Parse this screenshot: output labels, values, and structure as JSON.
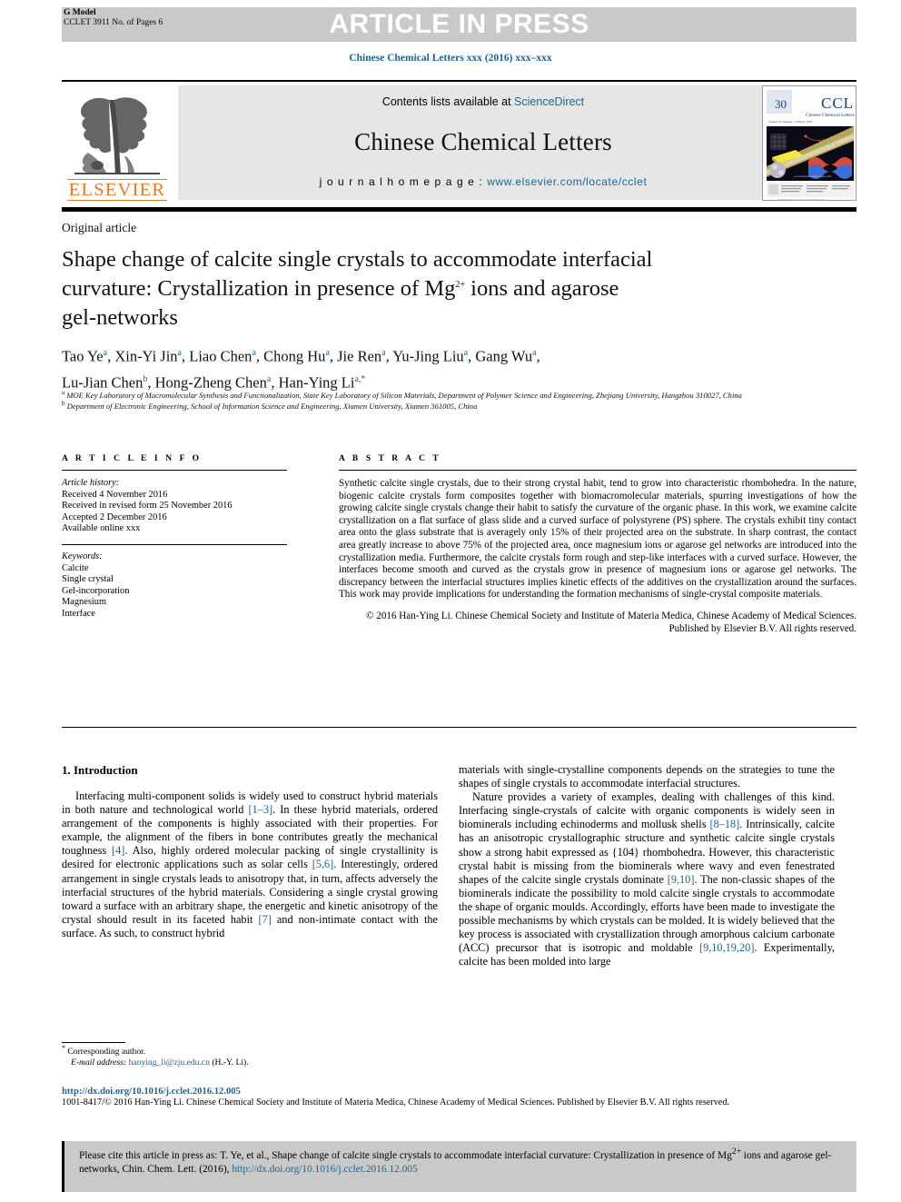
{
  "header": {
    "g_model_label": "G Model",
    "g_model_code": "CCLET 3911 No. of Pages 6",
    "article_in_press": "ARTICLE IN PRESS",
    "journal_ref": "Chinese Chemical Letters xxx (2016) xxx–xxx"
  },
  "masthead": {
    "contents_prefix": "Contents lists available at ",
    "sciencedirect": "ScienceDirect",
    "journal_title": "Chinese Chemical Letters",
    "homepage_label": "j o u r n a l  h o m e p a g e :  ",
    "homepage_url": "www.elsevier.com/locate/cclet",
    "publisher": "ELSEVIER",
    "cover_code": "CCL",
    "cover_sub": "Chinese Chemical Letters"
  },
  "title_block": {
    "article_type": "Original article",
    "title_line1": "Shape change of calcite single crystals to accommodate interfacial",
    "title_line2_a": "curvature: Crystallization in presence of Mg",
    "title_line2_sup": "2+",
    "title_line2_b": " ions and agarose",
    "title_line3": "gel-networks",
    "authors": "Tao Ye<a>, Xin-Yi Jin<a>, Liao Chen<a>, Chong Hu<a>, Jie Ren<a>, Yu-Jing Liu<a>, Gang Wu<a>, Lu-Jian Chen<b>, Hong-Zheng Chen<a>, Han-Ying Li<a,*>",
    "affiliation_a": "MOE Key Laboratory of Macromolecular Synthesis and Functionalization, State Key Laboratory of Silicon Materials, Department of Polymer Science and Engineering, Zhejiang University, Hangzhou 310027, China",
    "affiliation_b": "Department of Electronic Engineering, School of Information Science and Engineering, Xiamen University, Xiamen 361005, China"
  },
  "article_info": {
    "heading": "A R T I C L E   I N F O",
    "history_label": "Article history:",
    "history": [
      "Received 4 November 2016",
      "Received in revised form 25 November 2016",
      "Accepted 2 December 2016",
      "Available online xxx"
    ],
    "keywords_label": "Keywords:",
    "keywords": [
      "Calcite",
      "Single crystal",
      "Gel-incorporation",
      "Magnesium",
      "Interface"
    ]
  },
  "abstract": {
    "heading": "A B S T R A C T",
    "text": "Synthetic calcite single crystals, due to their strong crystal habit, tend to grow into characteristic rhombohedra. In the nature, biogenic calcite crystals form composites together with biomacromolecular materials, spurring investigations of how the growing calcite single crystals change their habit to satisfy the curvature of the organic phase. In this work, we examine calcite crystallization on a flat surface of glass slide and a curved surface of polystyrene (PS) sphere. The crystals exhibit tiny contact area onto the glass substrate that is averagely only 15% of their projected area on the substrate. In sharp contrast, the contact area greatly increase to above 75% of the projected area, once magnesium ions or agarose gel networks are introduced into the crystallization media. Furthermore, the calcite crystals form rough and step-like interfaces with a curved surface. However, the interfaces become smooth and curved as the crystals grow in presence of magnesium ions or agarose gel networks. The discrepancy between the interfacial structures implies kinetic effects of the additives on the crystallization around the surfaces. This work may provide implications for understanding the formation mechanisms of single-crystal composite materials.",
    "copyright": "© 2016 Han-Ying Li. Chinese Chemical Society and Institute of Materia Medica, Chinese Academy of Medical Sciences. Published by Elsevier B.V. All rights reserved."
  },
  "body": {
    "section_heading": "1. Introduction",
    "left_p1_a": "Interfacing multi-component solids is widely used to construct hybrid materials in both nature and technological world ",
    "left_p1_ref1": "[1–3]",
    "left_p1_b": ". In these hybrid materials, ordered arrangement of the components is highly associated with their properties. For example, the alignment of the fibers in bone contributes greatly the mechanical toughness ",
    "left_p1_ref2": "[4]",
    "left_p1_c": ". Also, highly ordered molecular packing of single crystallinity is desired for electronic applications such as solar cells ",
    "left_p1_ref3": "[5,6]",
    "left_p1_d": ". Interestingly, ordered arrangement in single crystals leads to anisotropy that, in turn, affects adversely the interfacial structures of the hybrid materials. Considering a single crystal growing toward a surface with an arbitrary shape, the energetic and kinetic anisotropy of the crystal should result in its faceted habit ",
    "left_p1_ref4": "[7]",
    "left_p1_e": " and non-intimate contact with the surface. As such, to construct hybrid",
    "right_p1": "materials with single-crystalline components depends on the strategies to tune the shapes of single crystals to accommodate interfacial structures.",
    "right_p2_a": "Nature provides a variety of examples, dealing with challenges of this kind. Interfacing single-crystals of calcite with organic components is widely seen in biominerals including echinoderms and mollusk shells ",
    "right_p2_ref1": "[8–18]",
    "right_p2_b": ". Intrinsically, calcite has an anisotropic crystallographic structure and synthetic calcite single crystals show a strong habit expressed as {104} rhombohedra. However, this characteristic crystal habit is missing from the biominerals where wavy and even fenestrated shapes of the calcite single crystals dominate ",
    "right_p2_ref2": "[9,10]",
    "right_p2_c": ". The non-classic shapes of the biominerals indicate the possibility to mold calcite single crystals to accommodate the shape of organic moulds. Accordingly, efforts have been made to investigate the possible mechanisms by which crystals can be molded. It is widely believed that the key process is associated with crystallization through amorphous calcium carbonate (ACC) precursor that is isotropic and moldable ",
    "right_p2_ref3": "[9,10,19,20]",
    "right_p2_d": ". Experimentally, calcite has been molded into large"
  },
  "footnote": {
    "corresponding": "Corresponding author.",
    "email_label": "E-mail address:",
    "email": "hanying_li@zju.edu.cn",
    "email_owner": "(H.-Y. Li)."
  },
  "footer": {
    "doi_url": "http://dx.doi.org/10.1016/j.cclet.2016.12.005",
    "issn_line": "1001-8417/© 2016 Han-Ying Li. Chinese Chemical Society and Institute of Materia Medica, Chinese Academy of Medical Sciences. Published by Elsevier B.V. All rights reserved."
  },
  "cite_box": {
    "text_a": "Please cite this article in press as: T. Ye, et al., Shape change of calcite single crystals to accommodate interfacial curvature: Crystallization in presence of Mg",
    "sup": "2+",
    "text_b": " ions and agarose gel-networks, Chin. Chem. Lett. (2016), ",
    "link": "http://dx.doi.org/10.1016/j.cclet.2016.12.005"
  },
  "colors": {
    "link": "#1a6496",
    "elsevier_orange": "#E87722",
    "bar_gray": "#c9c9c9",
    "masthead_gray": "#e6e6e6"
  }
}
